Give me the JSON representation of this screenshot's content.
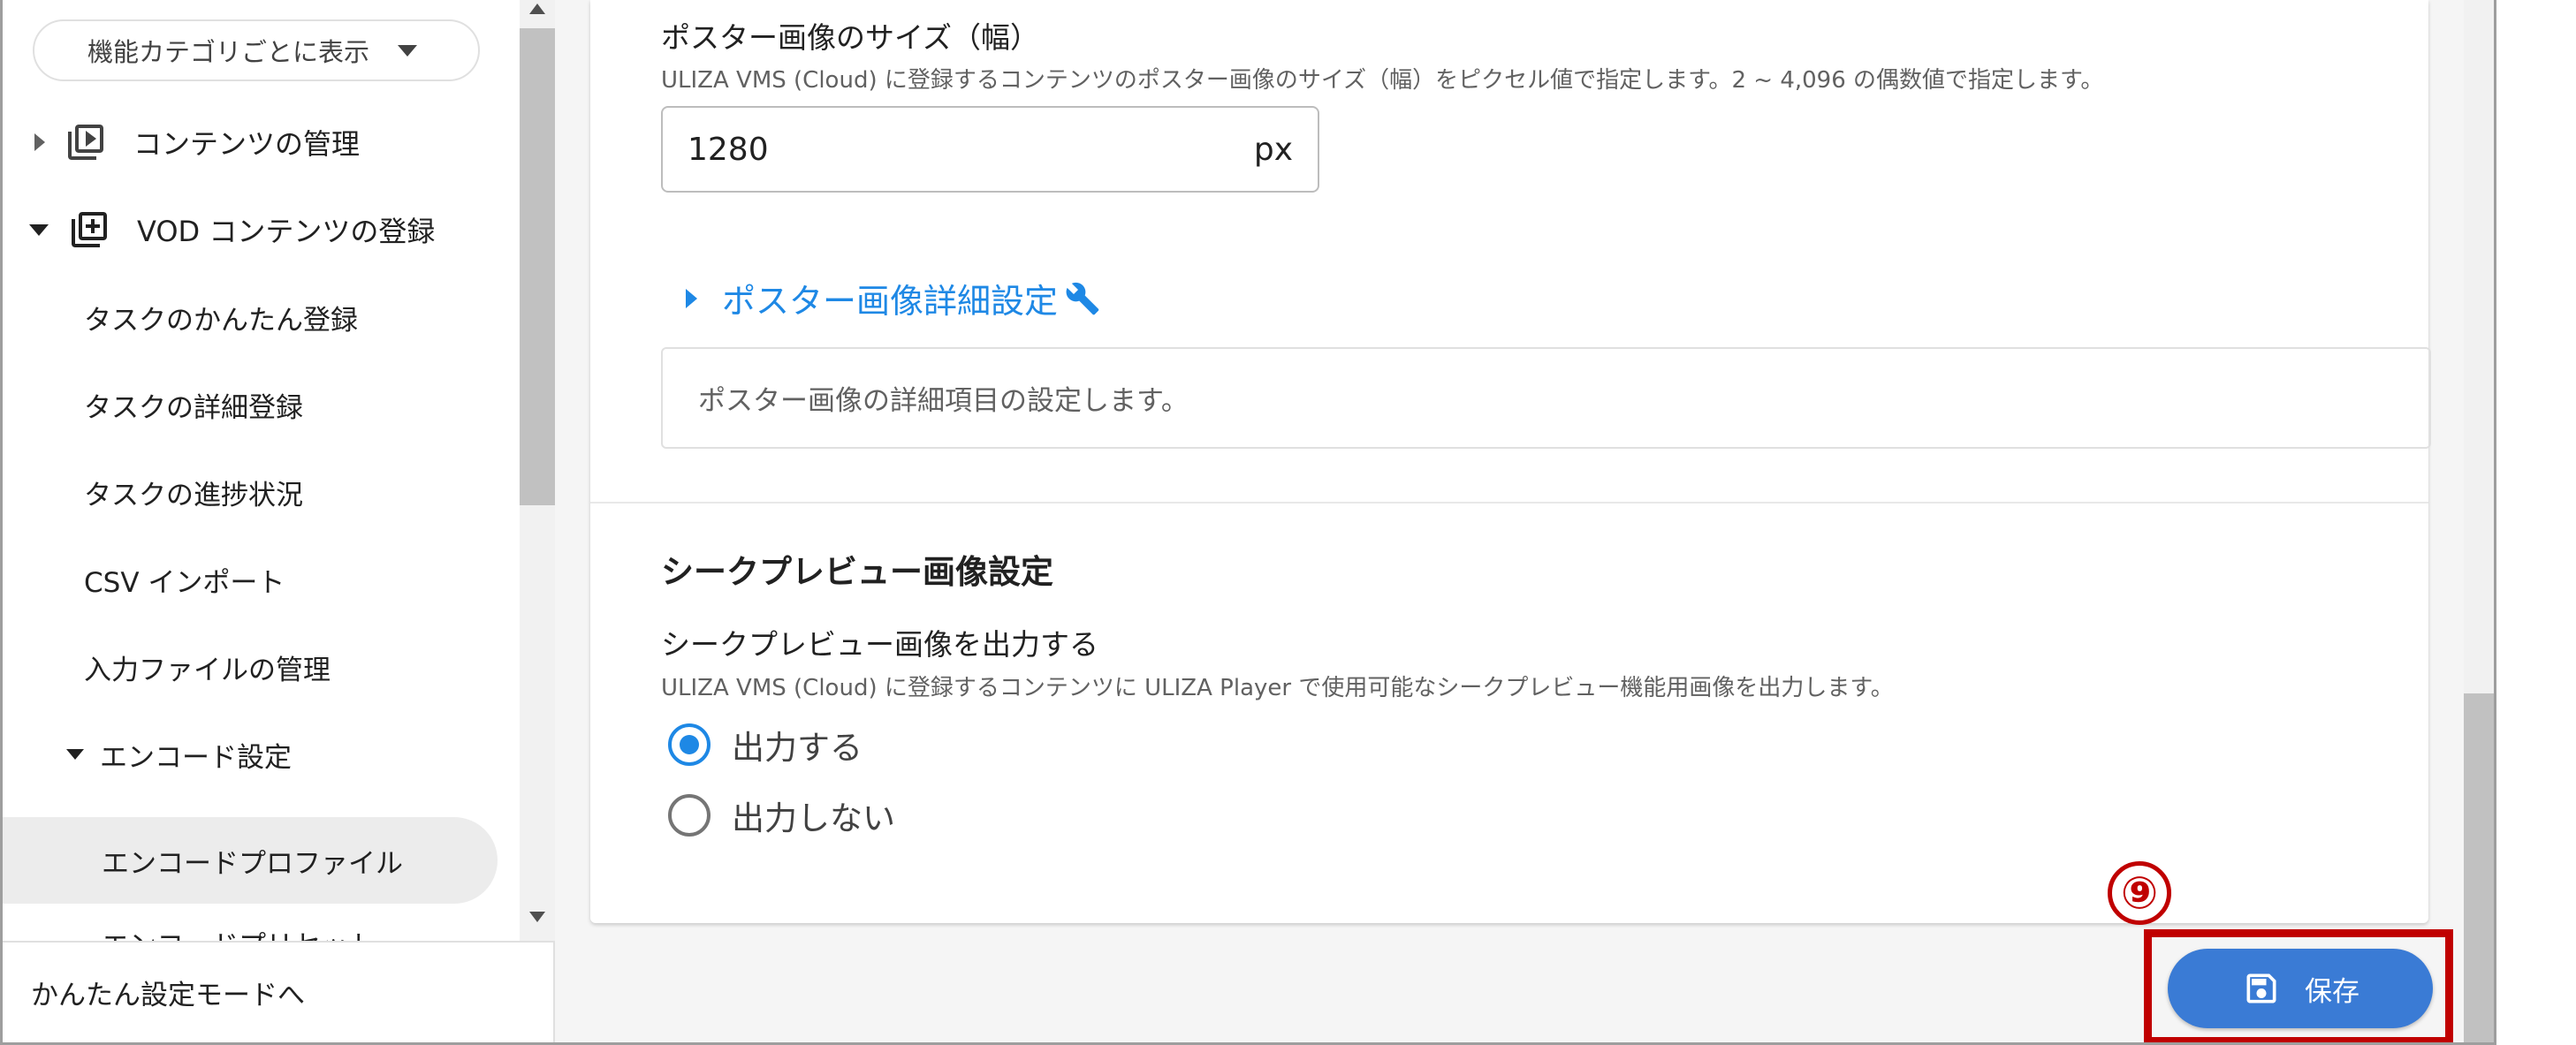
{
  "sidebar": {
    "category_select": "機能カテゴリごとに表示",
    "items": [
      {
        "label": "コンテンツの管理",
        "icon": "play-library-icon"
      },
      {
        "label": "VOD コンテンツの登録",
        "icon": "add-library-icon"
      }
    ],
    "sub_items": [
      "タスクのかんたん登録",
      "タスクの詳細登録",
      "タスクの進捗状況",
      "CSV インポート",
      "入力ファイルの管理"
    ],
    "encode_group": "エンコード設定",
    "selected_item": "エンコードプロファイル",
    "cut_item": "エンコードプリセット",
    "footer": "かんたん設定モードへ"
  },
  "poster": {
    "label": "ポスター画像のサイズ（幅）",
    "help": "ULIZA VMS (Cloud) に登録するコンテンツのポスター画像のサイズ（幅）をピクセル値で指定します。2 ~ 4,096 の偶数値で指定します。",
    "value": "1280",
    "unit": "px",
    "advanced_label": "ポスター画像詳細設定",
    "advanced_desc": "ポスター画像の詳細項目の設定します。"
  },
  "seek_preview": {
    "section_title": "シークプレビュー画像設定",
    "label": "シークプレビュー画像を出力する",
    "help": "ULIZA VMS (Cloud) に登録するコンテンツに ULIZA Player で使用可能なシークプレビュー機能用画像を出力します。",
    "options": [
      "出力する",
      "出力しない"
    ],
    "selected": "出力する"
  },
  "actions": {
    "save_label": "保存",
    "step_marker": "⑨"
  },
  "colors": {
    "accent": "#1e88e5",
    "save_button": "#3a7bd5",
    "highlight": "#c00000"
  }
}
